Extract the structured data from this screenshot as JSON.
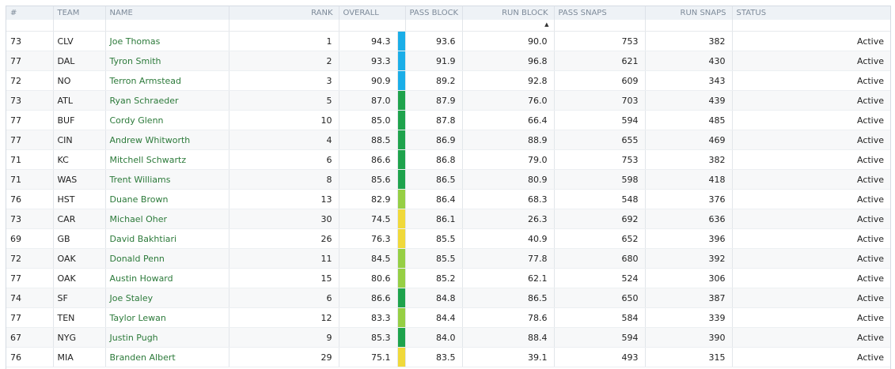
{
  "columns": {
    "num": "#",
    "team": "TEAM",
    "name": "NAME",
    "rank": "RANK",
    "overall": "OVERALL",
    "pass_block": "PASS BLOCK",
    "run_block": "RUN BLOCK",
    "pass_snaps": "PASS SNAPS",
    "run_snaps": "RUN SNAPS",
    "status": "STATUS"
  },
  "sort_indicator": "▲",
  "grade_colors": {
    "elite": "#1aaee8",
    "high": "#1ea34c",
    "good": "#96cf44",
    "average": "#f0d93a"
  },
  "rows": [
    {
      "num": "73",
      "team": "CLV",
      "name": "Joe Thomas",
      "rank": "1",
      "overall": "94.3",
      "grade": "elite",
      "pass_block": "93.6",
      "run_block": "90.0",
      "pass_snaps": "753",
      "run_snaps": "382",
      "status": "Active"
    },
    {
      "num": "77",
      "team": "DAL",
      "name": "Tyron Smith",
      "rank": "2",
      "overall": "93.3",
      "grade": "elite",
      "pass_block": "91.9",
      "run_block": "96.8",
      "pass_snaps": "621",
      "run_snaps": "430",
      "status": "Active"
    },
    {
      "num": "72",
      "team": "NO",
      "name": "Terron Armstead",
      "rank": "3",
      "overall": "90.9",
      "grade": "elite",
      "pass_block": "89.2",
      "run_block": "92.8",
      "pass_snaps": "609",
      "run_snaps": "343",
      "status": "Active"
    },
    {
      "num": "73",
      "team": "ATL",
      "name": "Ryan Schraeder",
      "rank": "5",
      "overall": "87.0",
      "grade": "high",
      "pass_block": "87.9",
      "run_block": "76.0",
      "pass_snaps": "703",
      "run_snaps": "439",
      "status": "Active"
    },
    {
      "num": "77",
      "team": "BUF",
      "name": "Cordy Glenn",
      "rank": "10",
      "overall": "85.0",
      "grade": "high",
      "pass_block": "87.8",
      "run_block": "66.4",
      "pass_snaps": "594",
      "run_snaps": "485",
      "status": "Active"
    },
    {
      "num": "77",
      "team": "CIN",
      "name": "Andrew Whitworth",
      "rank": "4",
      "overall": "88.5",
      "grade": "high",
      "pass_block": "86.9",
      "run_block": "88.9",
      "pass_snaps": "655",
      "run_snaps": "469",
      "status": "Active"
    },
    {
      "num": "71",
      "team": "KC",
      "name": "Mitchell Schwartz",
      "rank": "6",
      "overall": "86.6",
      "grade": "high",
      "pass_block": "86.8",
      "run_block": "79.0",
      "pass_snaps": "753",
      "run_snaps": "382",
      "status": "Active"
    },
    {
      "num": "71",
      "team": "WAS",
      "name": "Trent Williams",
      "rank": "8",
      "overall": "85.6",
      "grade": "high",
      "pass_block": "86.5",
      "run_block": "80.9",
      "pass_snaps": "598",
      "run_snaps": "418",
      "status": "Active"
    },
    {
      "num": "76",
      "team": "HST",
      "name": "Duane Brown",
      "rank": "13",
      "overall": "82.9",
      "grade": "good",
      "pass_block": "86.4",
      "run_block": "68.3",
      "pass_snaps": "548",
      "run_snaps": "376",
      "status": "Active"
    },
    {
      "num": "73",
      "team": "CAR",
      "name": "Michael Oher",
      "rank": "30",
      "overall": "74.5",
      "grade": "average",
      "pass_block": "86.1",
      "run_block": "26.3",
      "pass_snaps": "692",
      "run_snaps": "636",
      "status": "Active"
    },
    {
      "num": "69",
      "team": "GB",
      "name": "David Bakhtiari",
      "rank": "26",
      "overall": "76.3",
      "grade": "average",
      "pass_block": "85.5",
      "run_block": "40.9",
      "pass_snaps": "652",
      "run_snaps": "396",
      "status": "Active"
    },
    {
      "num": "72",
      "team": "OAK",
      "name": "Donald Penn",
      "rank": "11",
      "overall": "84.5",
      "grade": "good",
      "pass_block": "85.5",
      "run_block": "77.8",
      "pass_snaps": "680",
      "run_snaps": "392",
      "status": "Active"
    },
    {
      "num": "77",
      "team": "OAK",
      "name": "Austin Howard",
      "rank": "15",
      "overall": "80.6",
      "grade": "good",
      "pass_block": "85.2",
      "run_block": "62.1",
      "pass_snaps": "524",
      "run_snaps": "306",
      "status": "Active"
    },
    {
      "num": "74",
      "team": "SF",
      "name": "Joe Staley",
      "rank": "6",
      "overall": "86.6",
      "grade": "high",
      "pass_block": "84.8",
      "run_block": "86.5",
      "pass_snaps": "650",
      "run_snaps": "387",
      "status": "Active"
    },
    {
      "num": "77",
      "team": "TEN",
      "name": "Taylor Lewan",
      "rank": "12",
      "overall": "83.3",
      "grade": "good",
      "pass_block": "84.4",
      "run_block": "78.6",
      "pass_snaps": "584",
      "run_snaps": "339",
      "status": "Active"
    },
    {
      "num": "67",
      "team": "NYG",
      "name": "Justin Pugh",
      "rank": "9",
      "overall": "85.3",
      "grade": "high",
      "pass_block": "84.0",
      "run_block": "88.4",
      "pass_snaps": "594",
      "run_snaps": "390",
      "status": "Active"
    },
    {
      "num": "76",
      "team": "MIA",
      "name": "Branden Albert",
      "rank": "29",
      "overall": "75.1",
      "grade": "average",
      "pass_block": "83.5",
      "run_block": "39.1",
      "pass_snaps": "493",
      "run_snaps": "315",
      "status": "Active"
    }
  ]
}
